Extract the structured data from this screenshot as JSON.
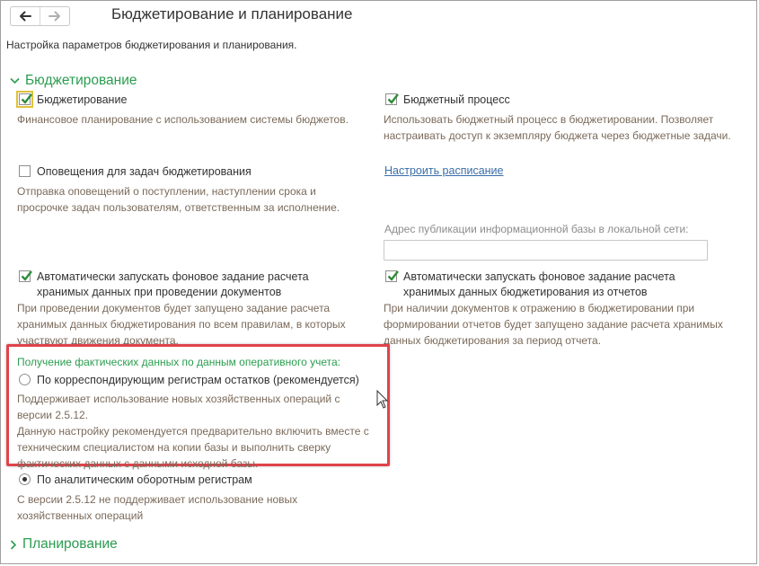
{
  "window": {
    "title": "Бюджетирование и планирование",
    "subtitle": "Настройка параметров бюджетирования и планирования."
  },
  "nav": {
    "back_icon": "arrow-left-icon",
    "forward_icon": "arrow-right-icon"
  },
  "sections": {
    "budgeting": {
      "title": "Бюджетирование",
      "expanded": true
    },
    "planning": {
      "title": "Планирование",
      "expanded": false
    }
  },
  "options": {
    "budgeting": {
      "label": "Бюджетирование",
      "checked": true,
      "desc": "Финансовое планирование с использованием системы бюджетов."
    },
    "budget_process": {
      "label": "Бюджетный процесс",
      "checked": true,
      "desc": "Использовать бюджетный процесс в бюджетировании. Позволяет настраивать доступ к экземпляру бюджета через бюджетные задачи."
    },
    "notifications": {
      "label": "Оповещения для задач бюджетирования",
      "checked": false,
      "desc": "Отправка оповещений о поступлении, наступлении срока и просрочке задач пользователям, ответственным за исполнение."
    },
    "schedule_link": "Настроить расписание",
    "publication": {
      "label": "Адрес публикации информационной базы в локальной сети:",
      "value": ""
    },
    "auto_docs": {
      "label_line1": "Автоматически запускать фоновое задание расчета",
      "label_line2": "хранимых данных при проведении документов",
      "checked": true,
      "desc": "При проведении документов будет запущено задание расчета хранимых данных бюджетирования по всем правилам, в которых участвуют движения документа."
    },
    "auto_reports": {
      "label_line1": "Автоматически запускать фоновое задание расчета",
      "label_line2": "хранимых данных бюджетирования из отчетов",
      "checked": true,
      "desc": "При наличии документов к отражению в бюджетировании при формировании отчетов будет запущено задание расчета хранимых данных бюджетирования за период отчета."
    }
  },
  "actual_data": {
    "label": "Получение фактических данных по данным оперативного учета:",
    "radio_balances": {
      "label": "По корреспондирующим регистрам остатков (рекомендуется)",
      "selected": false,
      "desc": "Поддерживает использование новых хозяйственных операций с версии 2.5.12.\nДанную настройку рекомендуется предварительно включить вместе с техническим специалистом на копии базы и выполнить сверку фактических данных с данными исходной базы."
    },
    "radio_turnovers": {
      "label": "По аналитическим оборотным регистрам",
      "selected": true,
      "desc": "С версии 2.5.12 не поддерживает использование новых хозяйственных операций"
    }
  },
  "colors": {
    "accent_green": "#2a9d4f",
    "highlight_red": "#e0434b",
    "link_blue": "#3a6ea8",
    "desc_text": "#7a6a5a"
  }
}
